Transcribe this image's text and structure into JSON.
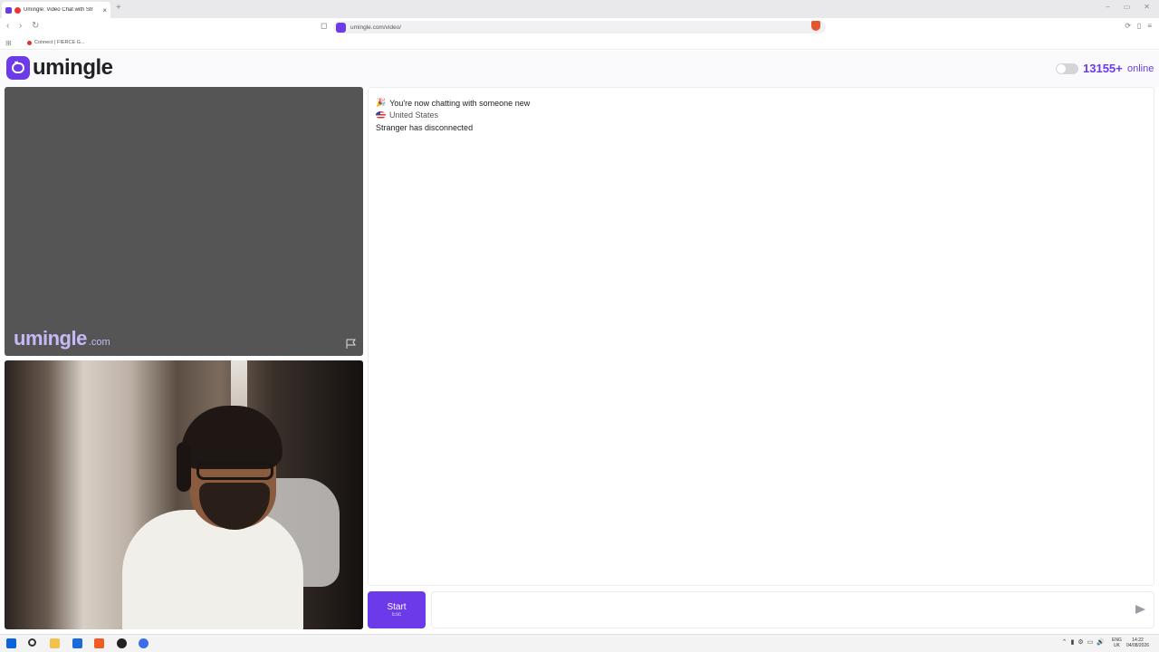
{
  "browser": {
    "tab_title": "Umingle: Video Chat with Str",
    "tab_close": "×",
    "new_tab": "+",
    "window_controls": [
      "–",
      "▭",
      "✕"
    ],
    "nav": {
      "back": "‹",
      "forward": "›",
      "reload": "↻"
    },
    "url": "umingle.com/video/",
    "bookmark_item": "Connect | FIERCE G..."
  },
  "site": {
    "logo_text": "umingle",
    "online_count": "13155+",
    "online_label": "online",
    "watermark_main": "umingle",
    "watermark_tld": ".com",
    "accent_color": "#6c3ae8"
  },
  "chat": {
    "messages": [
      {
        "icon": "party-popper-icon",
        "icon_glyph": "🎉",
        "text": "You're now chatting with someone new"
      },
      {
        "icon": "us-flag-icon",
        "text": "United States"
      },
      {
        "text": "Stranger has disconnected"
      }
    ],
    "input_placeholder": "",
    "start_button": "Start",
    "start_hint": "Esc"
  },
  "taskbar": {
    "tray": [
      "⌃",
      "▮",
      "⚙",
      "▭",
      "🔊"
    ],
    "language": [
      "ENG",
      "UK"
    ],
    "time": "14:22",
    "date": "04/08/2026"
  }
}
